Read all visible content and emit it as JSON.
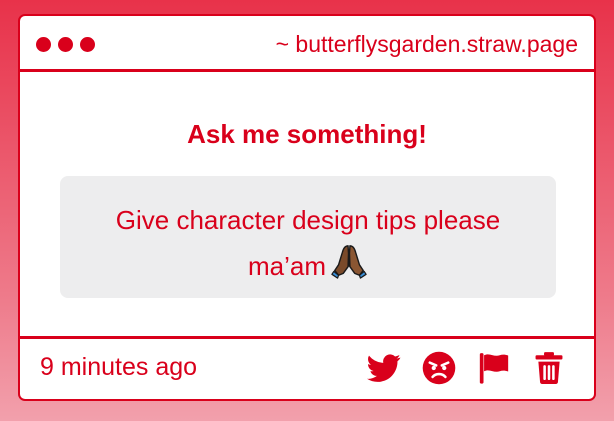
{
  "window": {
    "url": "~ butterflysgarden.straw.page"
  },
  "prompt": {
    "title": "Ask me something!"
  },
  "question": {
    "text": "Give character design tips please ma’am",
    "emoji_icon": "folded-hands-icon"
  },
  "footer": {
    "timestamp": "9 minutes ago",
    "actions": [
      {
        "name": "twitter-share",
        "icon": "twitter-bird-icon"
      },
      {
        "name": "react",
        "icon": "angry-face-icon"
      },
      {
        "name": "report",
        "icon": "flag-icon"
      },
      {
        "name": "delete",
        "icon": "trash-icon"
      }
    ]
  },
  "colors": {
    "accent": "#d9001b",
    "background_top": "#e8324a",
    "background_bottom": "#f2a0ac",
    "question_bg": "#ededee",
    "card_bg": "#ffffff"
  }
}
